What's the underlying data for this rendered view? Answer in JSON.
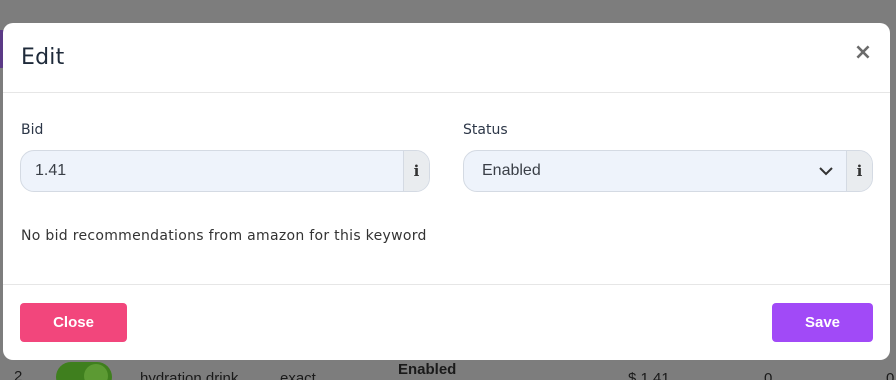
{
  "modal": {
    "title": "Edit",
    "close_symbol": "×",
    "bid": {
      "label": "Bid",
      "value": "1.41",
      "info_icon": "info-icon"
    },
    "status": {
      "label": "Status",
      "selected": "Enabled",
      "info_icon": "info-icon"
    },
    "hint": "No bid recommendations from amazon for this keyword",
    "buttons": {
      "close": "Close",
      "save": "Save"
    }
  },
  "background": {
    "status_text": "Enabled",
    "row_number": "2",
    "keyword": "hydration drink",
    "match_type": "exact",
    "bid": "$ 1.41",
    "count": "0",
    "trailing": "0"
  },
  "colors": {
    "close_button": "#f2467c",
    "save_button": "#a14af7",
    "input_bg": "#eef3fb"
  }
}
